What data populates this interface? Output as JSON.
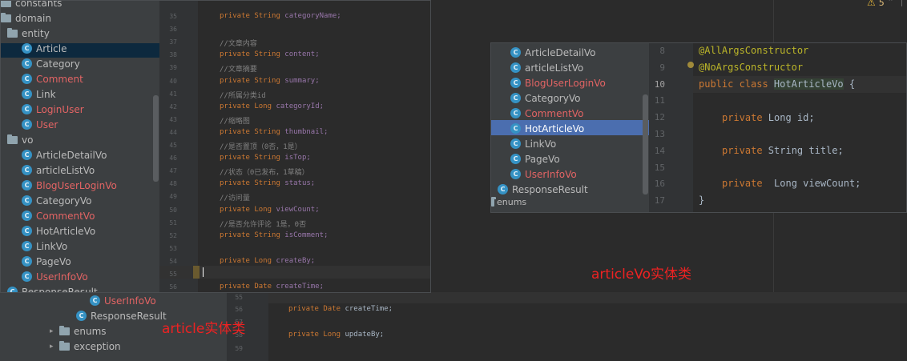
{
  "window_left": {
    "tree": [
      {
        "label": "constants",
        "type": "folder"
      },
      {
        "label": "domain",
        "type": "folder"
      },
      {
        "label": "entity",
        "type": "folder"
      },
      {
        "label": "Article",
        "type": "class",
        "selected": true
      },
      {
        "label": "Category",
        "type": "class"
      },
      {
        "label": "Comment",
        "type": "class",
        "modified": true
      },
      {
        "label": "Link",
        "type": "class"
      },
      {
        "label": "LoginUser",
        "type": "class",
        "modified": true
      },
      {
        "label": "User",
        "type": "class",
        "modified": true
      },
      {
        "label": "vo",
        "type": "folder"
      },
      {
        "label": "ArticleDetailVo",
        "type": "class"
      },
      {
        "label": "articleListVo",
        "type": "class"
      },
      {
        "label": "BlogUserLoginVo",
        "type": "class",
        "modified": true
      },
      {
        "label": "CategoryVo",
        "type": "class"
      },
      {
        "label": "CommentVo",
        "type": "class",
        "modified": true
      },
      {
        "label": "HotArticleVo",
        "type": "class"
      },
      {
        "label": "LinkVo",
        "type": "class"
      },
      {
        "label": "PageVo",
        "type": "class"
      },
      {
        "label": "UserInfoVo",
        "type": "class",
        "modified": true
      },
      {
        "label": "ResponseResult",
        "type": "class"
      }
    ],
    "line_numbers": [
      "35",
      "36",
      "37",
      "38",
      "39",
      "40",
      "41",
      "42",
      "43",
      "44",
      "45",
      "46",
      "47",
      "48",
      "49",
      "50",
      "51",
      "52",
      "53",
      "54",
      "55",
      "56"
    ],
    "code": [
      {
        "a": "private String ",
        "b": "categoryName;",
        "k": "decl"
      },
      {
        "a": "",
        "b": "",
        "k": "blank"
      },
      {
        "a": "//文章内容",
        "b": "",
        "k": "comment"
      },
      {
        "a": "private String ",
        "b": "content;",
        "k": "decl"
      },
      {
        "a": "//文章摘要",
        "b": "",
        "k": "comment"
      },
      {
        "a": "private String ",
        "b": "summary;",
        "k": "decl"
      },
      {
        "a": "//所属分类id",
        "b": "",
        "k": "comment"
      },
      {
        "a": "private Long ",
        "b": "categoryId;",
        "k": "decl"
      },
      {
        "a": "//缩略图",
        "b": "",
        "k": "comment"
      },
      {
        "a": "private String ",
        "b": "thumbnail;",
        "k": "decl"
      },
      {
        "a": "//是否置顶（0否，1是）",
        "b": "",
        "k": "comment"
      },
      {
        "a": "private String ",
        "b": "isTop;",
        "k": "decl"
      },
      {
        "a": "//状态（0已发布，1草稿）",
        "b": "",
        "k": "comment"
      },
      {
        "a": "private String ",
        "b": "status;",
        "k": "decl"
      },
      {
        "a": "//访问量",
        "b": "",
        "k": "comment"
      },
      {
        "a": "private Long ",
        "b": "viewCount;",
        "k": "decl"
      },
      {
        "a": "//是否允许评论 1是，0否",
        "b": "",
        "k": "comment"
      },
      {
        "a": "private String ",
        "b": "isComment;",
        "k": "decl"
      },
      {
        "a": "",
        "b": "",
        "k": "blank"
      },
      {
        "a": "private Long ",
        "b": "createBy;",
        "k": "decl"
      },
      {
        "a": "",
        "b": "",
        "k": "blank"
      },
      {
        "a": "private Date ",
        "b": "createTime;",
        "k": "decl"
      }
    ]
  },
  "window_right": {
    "tree": [
      {
        "label": "ArticleDetailVo",
        "modified": false
      },
      {
        "label": "articleListVo",
        "modified": false
      },
      {
        "label": "BlogUserLoginVo",
        "modified": true
      },
      {
        "label": "CategoryVo",
        "modified": false
      },
      {
        "label": "CommentVo",
        "modified": true
      },
      {
        "label": "HotArticleVo",
        "modified": false,
        "selected": true
      },
      {
        "label": "LinkVo",
        "modified": false
      },
      {
        "label": "PageVo",
        "modified": false
      },
      {
        "label": "UserInfoVo",
        "modified": true
      },
      {
        "label": "ResponseResult",
        "modified": false
      }
    ],
    "enums_label": "enums",
    "line_numbers": [
      "8",
      "9",
      "10",
      "11",
      "12",
      "13",
      "14",
      "15",
      "16",
      "17"
    ],
    "code": {
      "l8": "@AllArgsConstructor",
      "l9": "@NoArgsConstructor",
      "l10_kw": "public class ",
      "l10_name": "HotArticleVo",
      "l10_end": " {",
      "l12_kw": "private ",
      "l12_rest": "Long id;",
      "l14_kw": "private ",
      "l14_rest": "String title;",
      "l16_kw": "private  ",
      "l16_rest": "Long viewCount;",
      "l17": "}"
    }
  },
  "background": {
    "tree": [
      {
        "label": "UserInfoVo"
      },
      {
        "label": "ResponseResult"
      },
      {
        "label": "enums"
      },
      {
        "label": "exception"
      }
    ],
    "line_numbers": [
      "55",
      "56",
      "57",
      "58",
      "59"
    ],
    "code": [
      {
        "a": "private Date ",
        "b": "createTime;"
      },
      {
        "a": "private Long ",
        "b": "updateBy;"
      }
    ]
  },
  "captions": {
    "left": "article实体类",
    "right": "articleVo实体类"
  },
  "status": {
    "warnings": "5"
  },
  "class_icon_letter": "C",
  "colors": {
    "keyword": "#cc7832",
    "comment": "#808080",
    "annotation": "#bbb529",
    "modified_file": "#e36464",
    "selection": "#4b6eaf",
    "caption": "#ee2222"
  }
}
